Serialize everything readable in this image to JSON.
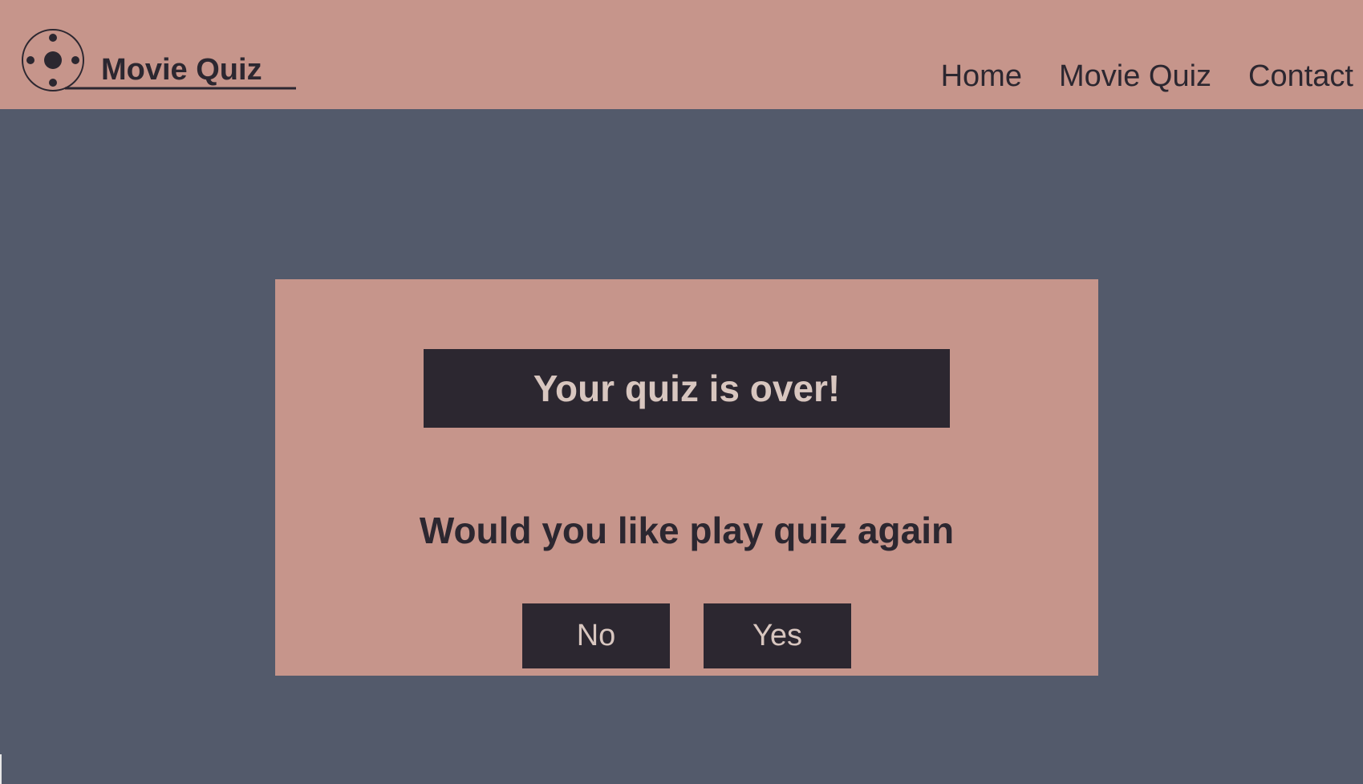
{
  "header": {
    "logo_text": "Movie Quiz",
    "logo_icon": "film-reel-icon",
    "nav": [
      "Home",
      "Movie Quiz",
      "Contact"
    ]
  },
  "quiz_end": {
    "title": "Your quiz is over!",
    "question": "Would you like play quiz again",
    "no_label": "No",
    "yes_label": "Yes"
  },
  "colors": {
    "header_bg": "#c6958b",
    "page_bg": "#535a6b",
    "dark": "#2c2730",
    "light_text": "#d8c6bf"
  }
}
